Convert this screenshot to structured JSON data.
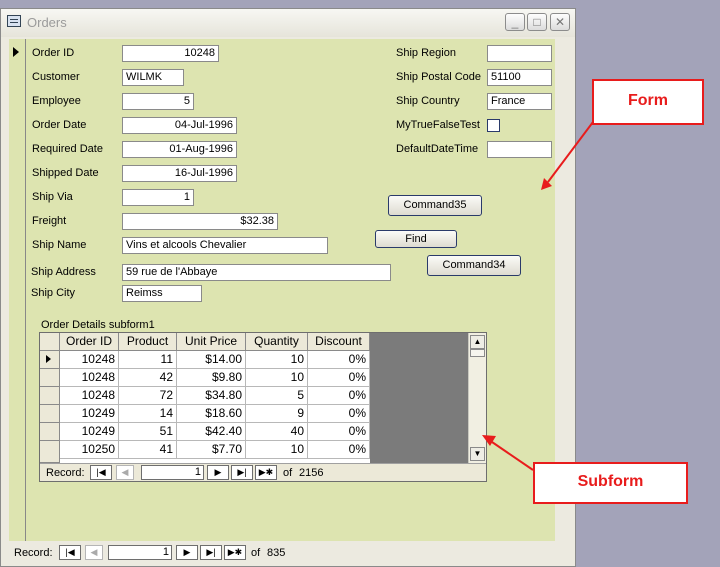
{
  "window": {
    "title": "Orders",
    "min_glyph": "_",
    "max_glyph": "□",
    "close_glyph": "✕"
  },
  "left_fields": [
    {
      "label": "Order ID",
      "value": "10248"
    },
    {
      "label": "Customer",
      "value": "WILMK"
    },
    {
      "label": "Employee",
      "value": "5"
    },
    {
      "label": "Order Date",
      "value": "04-Jul-1996"
    },
    {
      "label": "Required Date",
      "value": "01-Aug-1996"
    },
    {
      "label": "Shipped Date",
      "value": "16-Jul-1996"
    },
    {
      "label": "Ship Via",
      "value": "1"
    },
    {
      "label": "Freight",
      "value": "$32.38"
    },
    {
      "label": "Ship Name",
      "value": "Vins et alcools Chevalier"
    },
    {
      "label": "Ship Address",
      "value": "59 rue de l'Abbaye"
    },
    {
      "label": "Ship City",
      "value": "Reimss"
    }
  ],
  "right_fields": [
    {
      "label": "Ship Region",
      "value": ""
    },
    {
      "label": "Ship Postal Code",
      "value": "51100"
    },
    {
      "label": "Ship Country",
      "value": "France"
    },
    {
      "label": "MyTrueFalseTest",
      "value": ""
    },
    {
      "label": "DefaultDateTime",
      "value": ""
    }
  ],
  "buttons": {
    "command35": "Command35",
    "find": "Find",
    "command34": "Command34"
  },
  "subform": {
    "caption": "Order Details subform1",
    "columns": [
      "Order ID",
      "Product",
      "Unit Price",
      "Quantity",
      "Discount"
    ],
    "rows": [
      [
        "10248",
        "11",
        "$14.00",
        "10",
        "0%"
      ],
      [
        "10248",
        "42",
        "$9.80",
        "10",
        "0%"
      ],
      [
        "10248",
        "72",
        "$34.80",
        "5",
        "0%"
      ],
      [
        "10249",
        "14",
        "$18.60",
        "9",
        "0%"
      ],
      [
        "10249",
        "51",
        "$42.40",
        "40",
        "0%"
      ],
      [
        "10250",
        "41",
        "$7.70",
        "10",
        "0%"
      ]
    ],
    "nav": {
      "label": "Record:",
      "current": "1",
      "of_label": "of",
      "total": "2156"
    }
  },
  "main_nav": {
    "label": "Record:",
    "current": "1",
    "of_label": "of",
    "total": "835"
  },
  "annotations": {
    "form": "Form",
    "subform": "Subform"
  },
  "colors": {
    "form_background": "#dde4b0",
    "annotation_red": "#e81c1c",
    "desktop": "#a3a3b9"
  }
}
